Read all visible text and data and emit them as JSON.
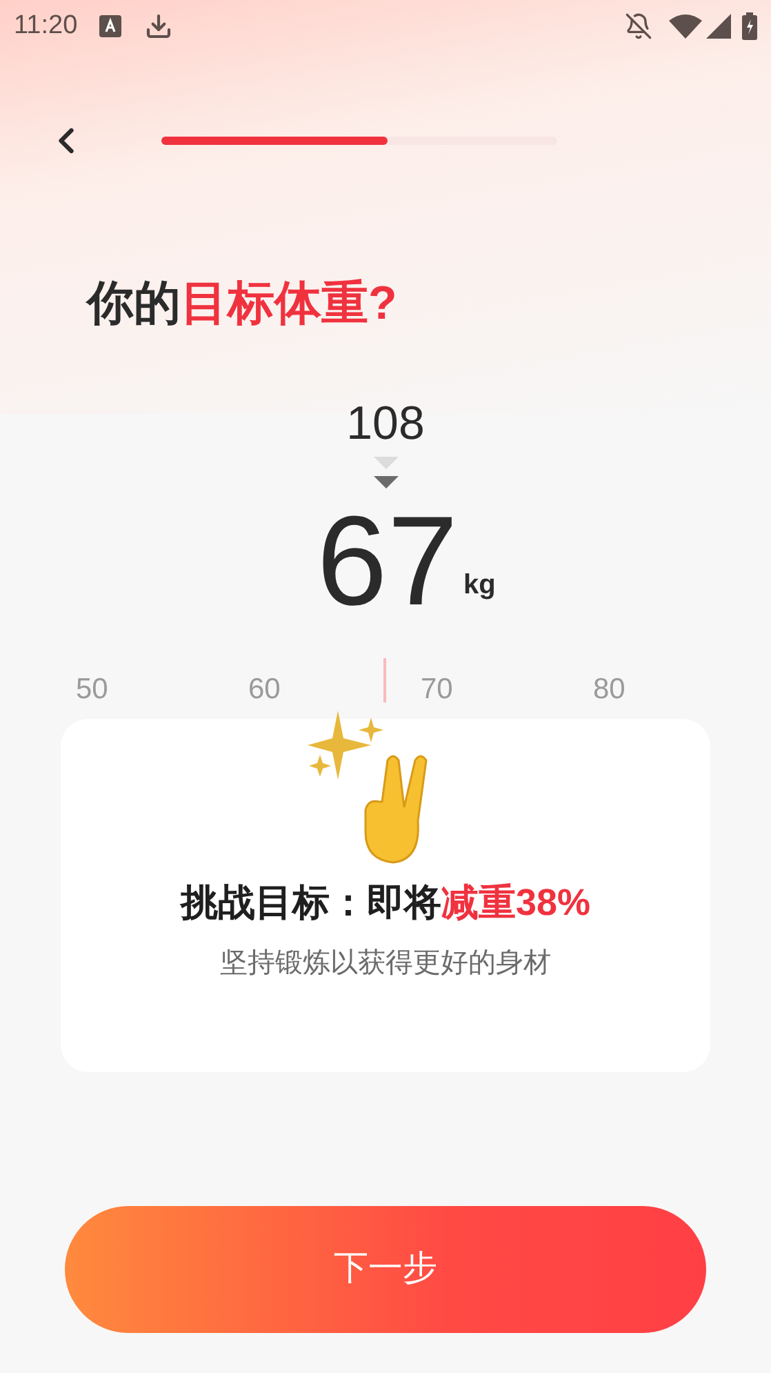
{
  "status_bar": {
    "time": "11:20"
  },
  "progress": {
    "level": 0.57
  },
  "title": {
    "prefix": "你的",
    "highlight": "目标体重?"
  },
  "picker": {
    "previous": "108",
    "value": "67",
    "unit": "kg",
    "ruler_labels": [
      "50",
      "60",
      "70",
      "80"
    ]
  },
  "card": {
    "headline_prefix": "挑战目标：即将",
    "headline_highlight": "减重38%",
    "subtitle": "坚持锻炼以获得更好的身材"
  },
  "next_button": {
    "label": "下一步"
  }
}
